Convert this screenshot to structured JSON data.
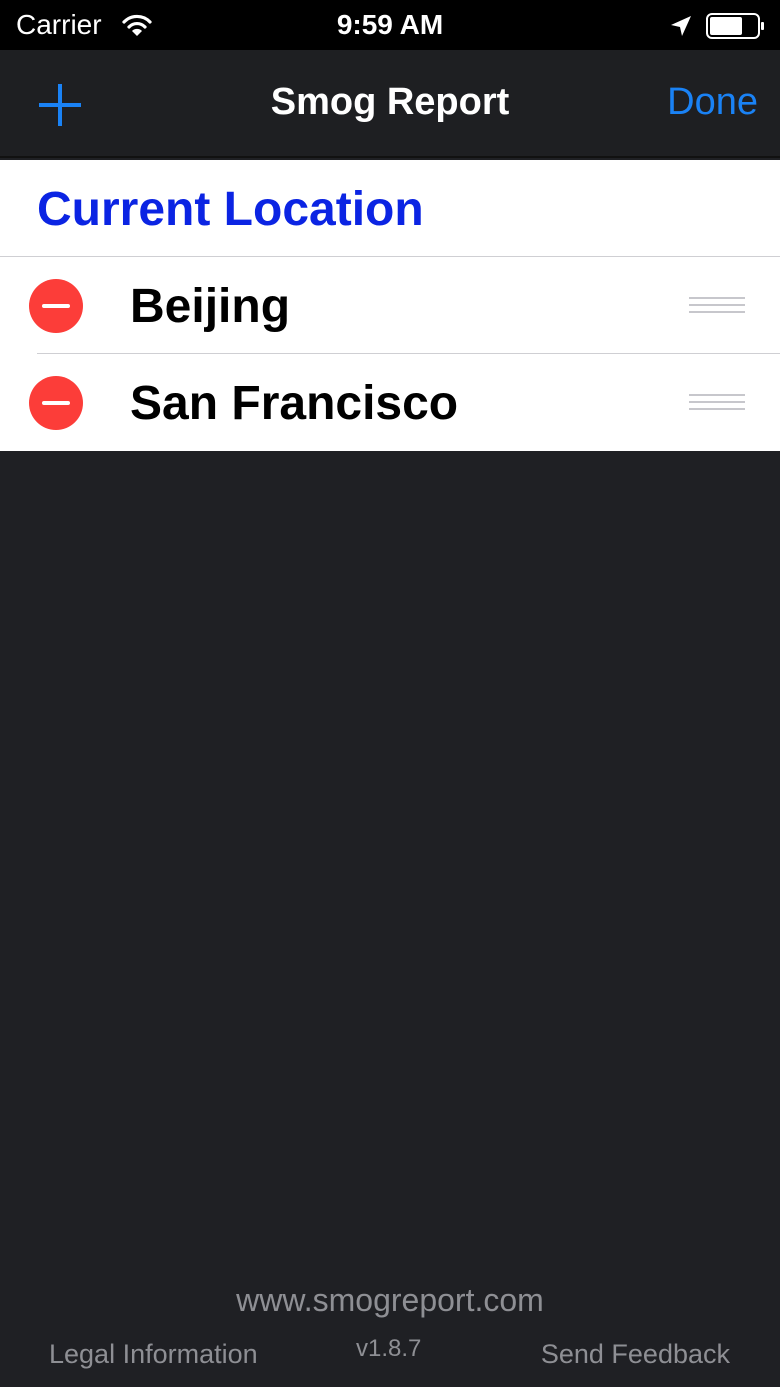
{
  "status_bar": {
    "carrier": "Carrier",
    "time": "9:59 AM",
    "icons": [
      "wifi-icon",
      "location-arrow-icon",
      "battery-icon"
    ]
  },
  "nav": {
    "add_icon": "plus-icon",
    "title": "Smog Report",
    "done_label": "Done"
  },
  "list": {
    "header": "Current Location",
    "cities": [
      {
        "name": "Beijing"
      },
      {
        "name": "San Francisco"
      }
    ]
  },
  "footer": {
    "url": "www.smogreport.com",
    "legal": "Legal Information",
    "version": "v1.8.7",
    "feedback": "Send Feedback"
  },
  "colors": {
    "accent": "#1a82f5",
    "header_text": "#0b24e3",
    "delete": "#fc3d39",
    "background": "#1f2024",
    "footer_text": "#8e8f94"
  }
}
